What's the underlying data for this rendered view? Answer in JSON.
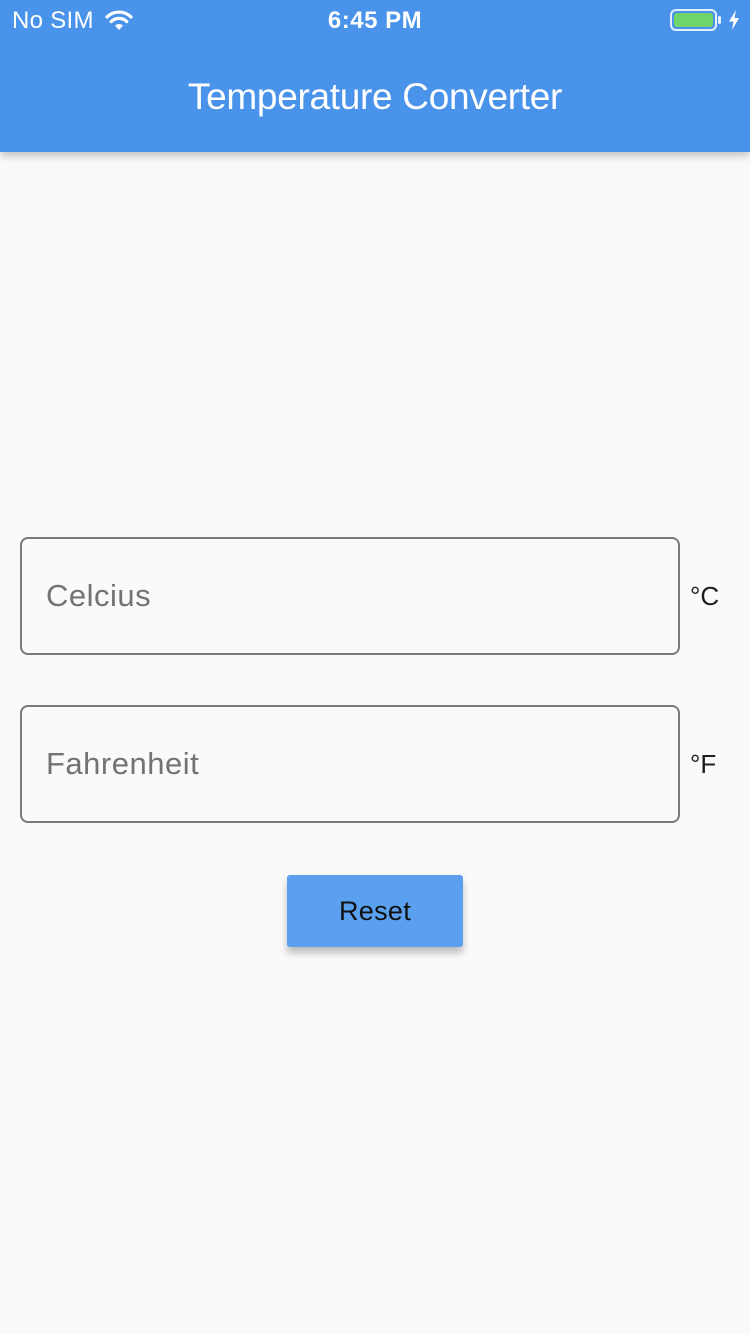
{
  "status_bar": {
    "carrier": "No SIM",
    "time": "6:45 PM",
    "icons": [
      "wifi-icon",
      "battery-icon",
      "charging-bolt-icon"
    ],
    "battery_color": "#6fd46a"
  },
  "app_bar": {
    "title": "Temperature Converter",
    "color": "#4a93ea"
  },
  "form": {
    "celsius": {
      "placeholder": "Celcius",
      "value": "",
      "unit": "°C"
    },
    "fahrenheit": {
      "placeholder": "Fahrenheit",
      "value": "",
      "unit": "°F"
    },
    "reset_label": "Reset",
    "reset_color": "#5aa0ee"
  }
}
